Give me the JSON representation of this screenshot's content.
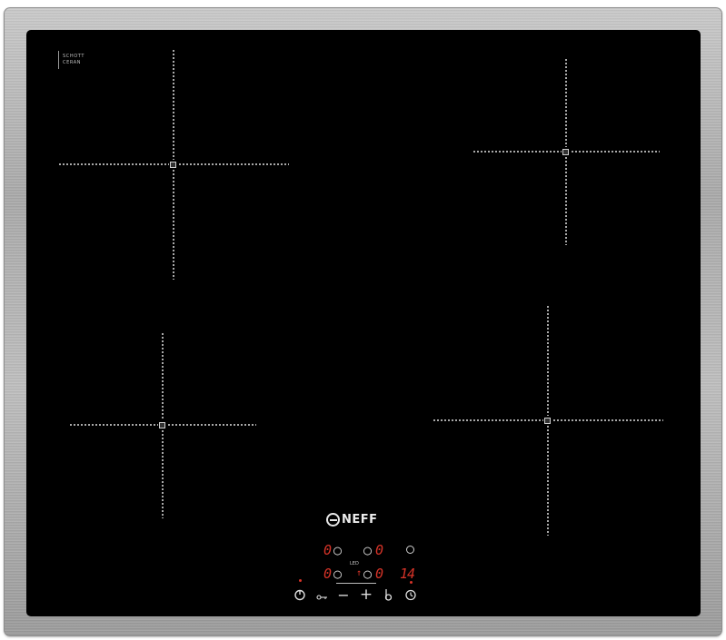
{
  "product": {
    "brand": "NEFF",
    "badge_line1": "SCHOTT",
    "badge_line2": "CERAN",
    "glass_color": "#000000",
    "frame_color": "#b4b4b4"
  },
  "display": {
    "zone_front_left_level": "0",
    "zone_rear_left_level": "0",
    "zone_rear_right_level": "0",
    "zone_front_right_level": "0",
    "power_symbol": "○",
    "small_label": "LED",
    "arrow": "↑",
    "timer_digits": "14",
    "accent_color": "#d63328"
  },
  "controls": {
    "power_icon": "power-icon",
    "lock_icon": "child-lock-icon",
    "minus_label": "−",
    "plus_label": "+",
    "wipe_protect_icon": "wipe-protect-icon",
    "timer_icon": "timer-icon",
    "timer_top_icon": "power-boost-icon"
  }
}
